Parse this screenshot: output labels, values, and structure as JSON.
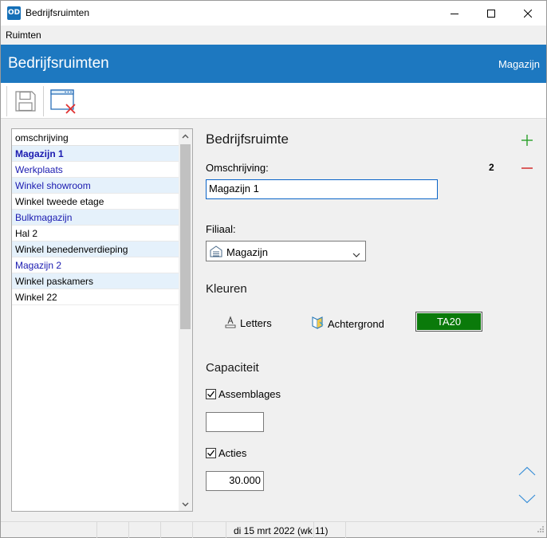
{
  "window": {
    "icon_text": "OD",
    "title": "Bedrijfsruimten"
  },
  "menu": {
    "items": [
      "Ruimten"
    ]
  },
  "header": {
    "title": "Bedrijfsruimten",
    "context": "Magazijn"
  },
  "list": {
    "column_header": "omschrijving",
    "rows": [
      "Magazijn 1",
      "Werkplaats",
      "Winkel showroom",
      "Winkel tweede etage",
      "Bulkmagazijn",
      "Hal 2",
      "Winkel benedenverdieping",
      "Magazijn 2",
      "Winkel paskamers",
      "Winkel 22"
    ]
  },
  "detail": {
    "section_title": "Bedrijfsruimte",
    "counter": "2",
    "description_label": "Omschrijving:",
    "description_value": "Magazijn 1",
    "branch_label": "Filiaal:",
    "branch_value": "Magazijn",
    "colors_title": "Kleuren",
    "letters_label": "Letters",
    "background_label": "Achtergrond",
    "swatch_label": "TA20",
    "swatch_color": "#0a7a0a",
    "capacity_title": "Capaciteit",
    "assemblies_label": "Assemblages",
    "assemblies_checked": true,
    "assemblies_value": "",
    "actions_label": "Acties",
    "actions_checked": true,
    "actions_value": "30.000"
  },
  "statusbar": {
    "date_text": "di 15 mrt 2022 (wk 11)"
  },
  "colors": {
    "header_blue": "#1d78c0",
    "add_green": "#2aa02a",
    "remove_red": "#d02020",
    "nav_blue": "#3a8fd8"
  }
}
